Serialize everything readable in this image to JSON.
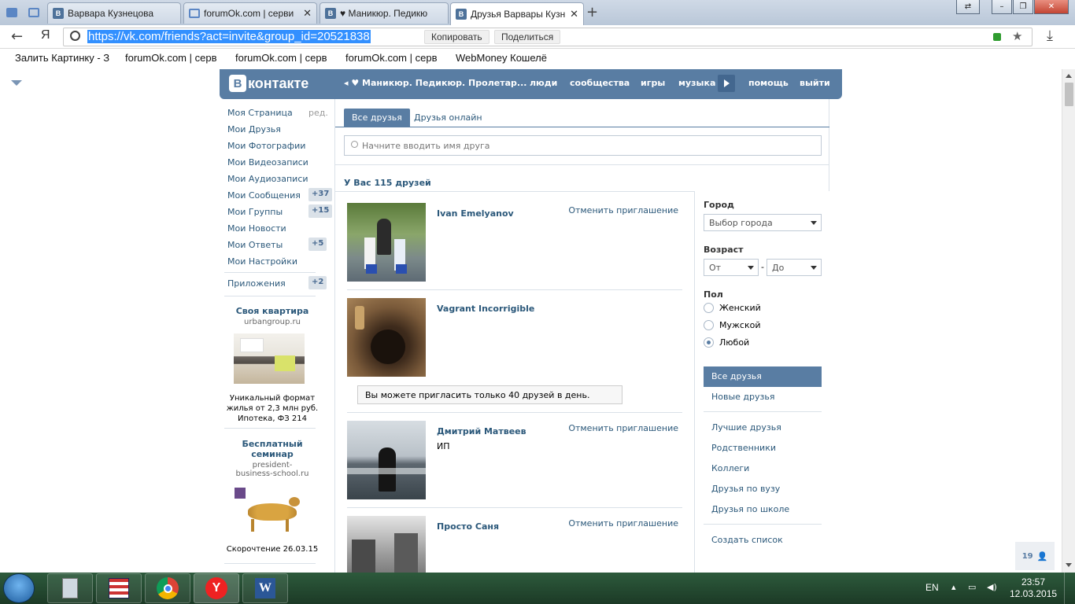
{
  "browser": {
    "tabs": [
      {
        "title": "Варвара Кузнецова",
        "icon": "vk-icon",
        "active": false
      },
      {
        "title": "forumOk.com | серви",
        "icon": "book-icon",
        "active": false
      },
      {
        "title": "♥ Маникюр. Педикю",
        "icon": "vk-icon",
        "active": false
      },
      {
        "title": "Друзья Варвары Кузн",
        "icon": "vk-icon",
        "active": true
      }
    ],
    "nav_ya": "Я",
    "url": "https://vk.com/friends?act=invite&group_id=20521838",
    "copy_label": "Копировать",
    "share_label": "Поделиться",
    "bookmarks": [
      "Залить Картинку - З",
      "forumOk.com | серв",
      "forumOk.com | серв",
      "forumOk.com | серв",
      "WebMoney Кошелё"
    ]
  },
  "vk": {
    "logo_letter": "В",
    "logo_text": "контакте",
    "audio_track": "◂ ♥ Маникюр. Педикюр. Пролетар...",
    "nav": [
      "люди",
      "сообщества",
      "игры",
      "музыка",
      "помощь",
      "выйти"
    ],
    "left_menu": [
      {
        "label": "Моя Страница",
        "extra": "ред."
      },
      {
        "label": "Мои Друзья",
        "extra": ""
      },
      {
        "label": "Мои Фотографии",
        "extra": ""
      },
      {
        "label": "Мои Видеозаписи",
        "extra": ""
      },
      {
        "label": "Мои Аудиозаписи",
        "extra": ""
      },
      {
        "label": "Мои Сообщения",
        "extra": "+37"
      },
      {
        "label": "Мои Группы",
        "extra": "+15"
      },
      {
        "label": "Мои Новости",
        "extra": ""
      },
      {
        "label": "Мои Ответы",
        "extra": "+5"
      },
      {
        "label": "Мои Настройки",
        "extra": ""
      }
    ],
    "apps": {
      "label": "Приложения",
      "extra": "+2"
    },
    "ads": [
      {
        "title": "Своя квартира",
        "site": "urbangroup.ru",
        "desc": "Уникальный формат жилья от 2,3 млн руб. Ипотека, ФЗ 214"
      },
      {
        "title": "Бесплатный семинар",
        "site": "president-business-school.ru",
        "desc": "Скорочтение 26.03.15"
      }
    ],
    "tabs": [
      "Все друзья",
      "Друзья онлайн"
    ],
    "search_placeholder": "Начните вводить имя друга",
    "friends_count": "У Вас 115 друзей",
    "friends": [
      {
        "name": "Ivan Emelyanov",
        "sub": "",
        "action": "Отменить приглашение"
      },
      {
        "name": "Vagrant Incorrigible",
        "sub": "",
        "action": ""
      },
      {
        "name": "Дмитрий Матвеев",
        "sub": "ИП",
        "action": "Отменить приглашение"
      },
      {
        "name": "Просто Саня",
        "sub": "",
        "action": "Отменить приглашение"
      }
    ],
    "invite_notice": "Вы можете пригласить только 40 друзей в день.",
    "filters": {
      "city_label": "Город",
      "city_value": "Выбор города",
      "age_label": "Возраст",
      "age_from": "От",
      "age_dash": "-",
      "age_to": "До",
      "sex_label": "Пол",
      "sex_options": [
        "Женский",
        "Мужской",
        "Любой"
      ],
      "sex_selected": "Любой",
      "menu": [
        "Все друзья",
        "Новые друзья",
        "Лучшие друзья",
        "Родственники",
        "Коллеги",
        "Друзья по вузу",
        "Друзья по школе",
        "Создать список"
      ]
    },
    "online_count": "19"
  },
  "taskbar": {
    "lang": "EN",
    "time": "23:57",
    "date": "12.03.2015"
  },
  "colors": {
    "vk_blue": "#597da3",
    "link": "#2b587a"
  }
}
